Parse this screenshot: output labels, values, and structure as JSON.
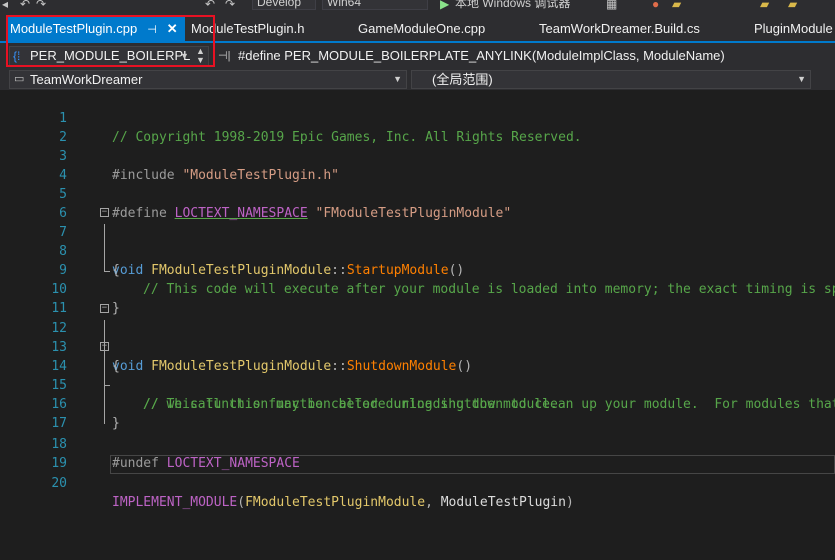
{
  "toolbar": {
    "config_combo": "Develop",
    "platform_combo": "Win64",
    "debug_target": "本地 Windows 调试器"
  },
  "tabs": [
    {
      "label": "ModuleTestPlugin.cpp",
      "active": true
    },
    {
      "label": "ModuleTestPlugin.h",
      "active": false
    },
    {
      "label": "GameModuleOne.cpp",
      "active": false
    },
    {
      "label": "TeamWorkDreamer.Build.cs",
      "active": false
    },
    {
      "label": "PluginModule",
      "active": false
    }
  ],
  "navbar": {
    "member_combo": "PER_MODULE_BOILERPL",
    "macro_text": "#define PER_MODULE_BOILERPLATE_ANYLINK(ModuleImplClass, ModuleName)"
  },
  "scope": {
    "project": "TeamWorkDreamer",
    "scope": "(全局范围)"
  },
  "editor": {
    "line_numbers": [
      "1",
      "2",
      "3",
      "4",
      "5",
      "6",
      "7",
      "8",
      "9",
      "10",
      "11",
      "12",
      "13",
      "14",
      "15",
      "16",
      "17",
      "18",
      "19",
      "20"
    ],
    "lines": {
      "l1": "// Copyright 1998-2019 Epic Games, Inc. All Rights Reserved.",
      "l3_kw": "#include ",
      "l3_str": "\"ModuleTestPlugin.h\"",
      "l5_kw": "#define ",
      "l5_macro": "LOCTEXT_NAMESPACE",
      "l5_str": " \"FModuleTestPluginModule\"",
      "l7_kw": "void ",
      "l7_class": "FModuleTestPluginModule",
      "l7_sep": "::",
      "l7_func": "StartupModule",
      "l7_paren": "()",
      "l8": "{",
      "l9": "// This code will execute after your module is loaded into memory; the exact timing is sp",
      "l10": "}",
      "l12_kw": "void ",
      "l12_class": "FModuleTestPluginModule",
      "l12_sep": "::",
      "l12_func": "ShutdownModule",
      "l12_paren": "()",
      "l13": "{",
      "l14": "// This function may be called during shutdown to clean up your module.  For modules that",
      "l15": "// we call this function before unloading the module.",
      "l16": "}",
      "l18_kw": "#undef ",
      "l18_macro": "LOCTEXT_NAMESPACE",
      "l20_macro": "IMPLEMENT_MODULE",
      "l20_p1": "(",
      "l20_class": "FModuleTestPluginModule",
      "l20_mid": ", ",
      "l20_arg": "ModuleTestPlugin",
      "l20_p2": ")"
    }
  },
  "colors": {
    "accent": "#007acc",
    "highlight_box": "#e81123"
  }
}
